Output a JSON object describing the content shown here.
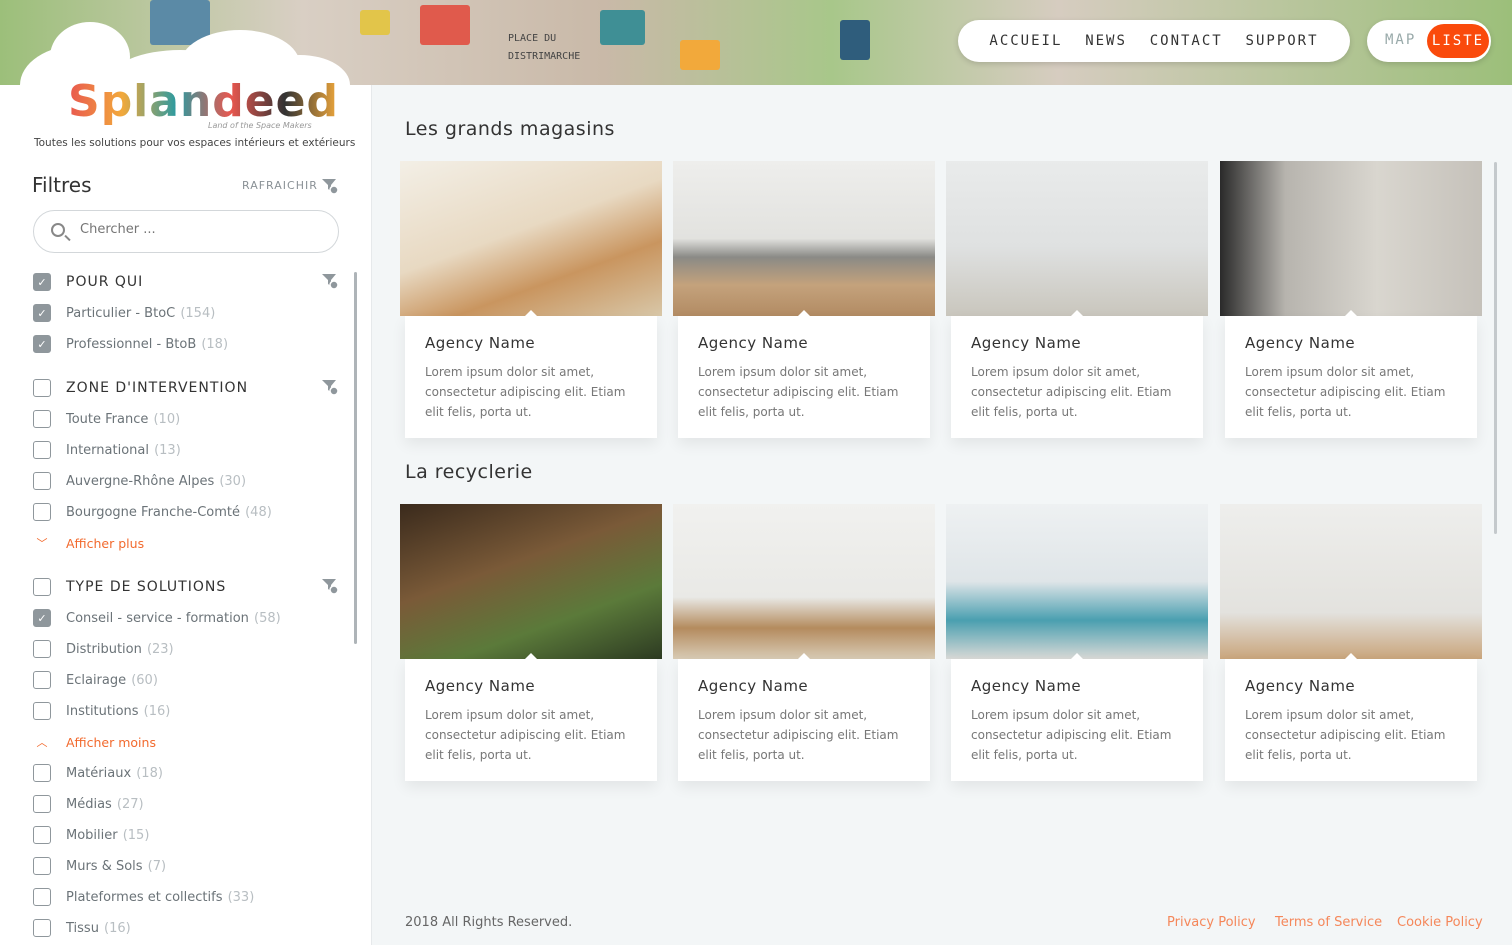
{
  "header": {
    "nav": [
      "ACCUEIL",
      "NEWS",
      "CONTACT",
      "SUPPORT"
    ],
    "view_toggle": {
      "map": "MAP",
      "liste": "LISTE",
      "active": "LISTE"
    },
    "accent": "#fa4a0c",
    "map_labels": [
      "PLACE DU",
      "DISTRIMARCHE"
    ]
  },
  "brand": {
    "logo": "Splandeed",
    "logo_sub": "Land of the Space Makers",
    "tagline": "Toutes les solutions pour vos espaces intérieurs et extérieurs"
  },
  "filters": {
    "title": "Filtres",
    "refresh": "RAFRAICHIR",
    "search_placeholder": "Chercher ...",
    "groups": [
      {
        "label": "POUR QUI",
        "checked": true,
        "options": [
          {
            "label": "Particulier - BtoC",
            "count": "(154)",
            "checked": true
          },
          {
            "label": "Professionnel - BtoB",
            "count": "(18)",
            "checked": true
          }
        ]
      },
      {
        "label": "ZONE D'INTERVENTION",
        "checked": false,
        "options": [
          {
            "label": "Toute France",
            "count": "(10)",
            "checked": false
          },
          {
            "label": "International",
            "count": "(13)",
            "checked": false
          },
          {
            "label": "Auvergne-Rhône Alpes",
            "count": "(30)",
            "checked": false
          },
          {
            "label": "Bourgogne Franche-Comté",
            "count": "(48)",
            "checked": false
          }
        ],
        "toggle": "Afficher plus"
      },
      {
        "label": "TYPE DE SOLUTIONS",
        "checked": false,
        "options": [
          {
            "label": "Conseil - service - formation",
            "count": "(58)",
            "checked": true
          },
          {
            "label": "Distribution",
            "count": "(23)",
            "checked": false
          },
          {
            "label": "Eclairage",
            "count": "(60)",
            "checked": false
          },
          {
            "label": "Institutions",
            "count": "(16)",
            "checked": false
          }
        ],
        "toggle": "Afficher moins",
        "more_options": [
          {
            "label": "Matériaux",
            "count": "(18)",
            "checked": false
          },
          {
            "label": "Médias",
            "count": "(27)",
            "checked": false
          },
          {
            "label": "Mobilier",
            "count": "(15)",
            "checked": false
          },
          {
            "label": "Murs & Sols",
            "count": "(7)",
            "checked": false
          },
          {
            "label": "Plateformes et collectifs",
            "count": "(33)",
            "checked": false
          },
          {
            "label": "Tissu",
            "count": "(16)",
            "checked": false
          }
        ]
      }
    ]
  },
  "sections": [
    {
      "title": "Les grands magasins",
      "cards": [
        {
          "name": "Agency Name",
          "text": "Lorem ipsum dolor sit amet, consectetur adipiscing elit. Etiam elit felis, porta ut."
        },
        {
          "name": "Agency Name",
          "text": "Lorem ipsum dolor sit amet, consectetur adipiscing elit. Etiam elit felis, porta ut."
        },
        {
          "name": "Agency Name",
          "text": "Lorem ipsum dolor sit amet, consectetur adipiscing elit. Etiam elit felis, porta ut."
        },
        {
          "name": "Agency Name",
          "text": "Lorem ipsum dolor sit amet, consectetur adipiscing elit. Etiam elit felis, porta ut."
        }
      ]
    },
    {
      "title": "La recyclerie",
      "cards": [
        {
          "name": "Agency Name",
          "text": "Lorem ipsum dolor sit amet, consectetur adipiscing elit. Etiam elit felis, porta ut."
        },
        {
          "name": "Agency Name",
          "text": "Lorem ipsum dolor sit amet, consectetur adipiscing elit. Etiam elit felis, porta ut."
        },
        {
          "name": "Agency Name",
          "text": "Lorem ipsum dolor sit amet, consectetur adipiscing elit. Etiam elit felis, porta ut."
        },
        {
          "name": "Agency Name",
          "text": "Lorem ipsum dolor sit amet, consectetur adipiscing elit. Etiam elit felis, porta ut."
        }
      ]
    }
  ],
  "footer": {
    "copyright": "2018 All Rights Reserved.",
    "links": [
      "Privacy Policy",
      "Terms of Service",
      "Cookie Policy"
    ]
  }
}
